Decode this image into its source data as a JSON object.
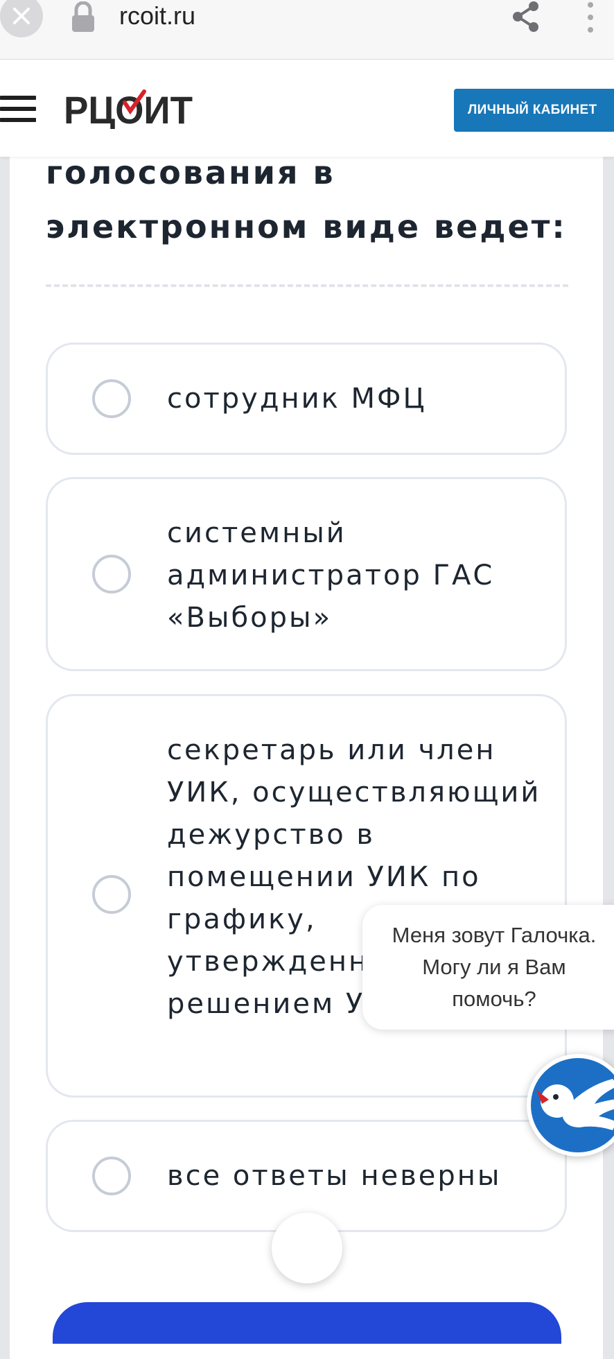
{
  "browser": {
    "url": "rcoit.ru"
  },
  "header": {
    "logo_text": "РЦОИТ",
    "cabinet_button": "ЛИЧНЫЙ КАБИНЕТ"
  },
  "question": {
    "text": "голосования в электронном виде ведет:"
  },
  "options": [
    {
      "label": "сотрудник МФЦ"
    },
    {
      "label": "системный администратор ГАС «Выборы»"
    },
    {
      "label": "секретарь или член УИК, осуществляющий дежурство в помещении УИК по графику, утвержденному решением УИК"
    },
    {
      "label": "все ответы неверны"
    }
  ],
  "chat": {
    "bubble_text": "Меня зовут Галочка. Могу ли я Вам помочь?"
  },
  "colors": {
    "accent": "#1877b8",
    "submit": "#2347d6",
    "logo_check": "#d6232a"
  }
}
